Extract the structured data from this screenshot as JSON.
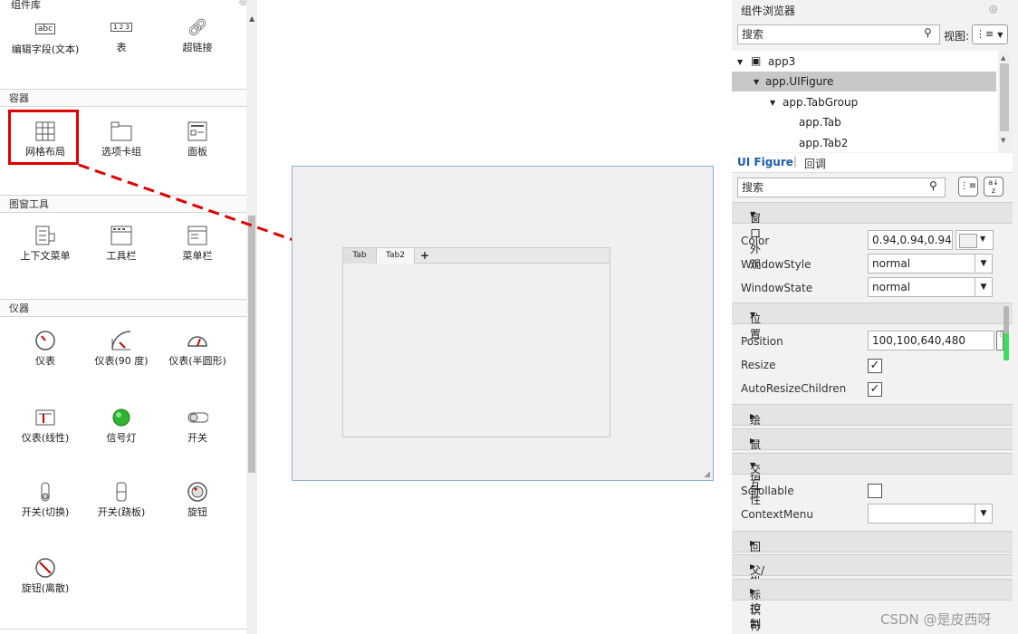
{
  "library": {
    "header": "组件库",
    "top_items": [
      {
        "icon": "text-area-icon",
        "icon_text": "abc",
        "label": "编辑字段(文本)"
      },
      {
        "icon": "table-icon",
        "icon_text": "1 2 3",
        "label": "表"
      },
      {
        "icon": "hyperlink-icon",
        "label": "超链接"
      }
    ],
    "sections": [
      {
        "title": "容器",
        "items": [
          {
            "icon": "grid-layout-icon",
            "label": "网格布局"
          },
          {
            "icon": "tab-group-icon",
            "label": "选项卡组"
          },
          {
            "icon": "panel-icon",
            "label": "面板"
          }
        ]
      },
      {
        "title": "图窗工具",
        "items": [
          {
            "icon": "context-menu-icon",
            "label": "上下文菜单"
          },
          {
            "icon": "toolbar-icon",
            "label": "工具栏"
          },
          {
            "icon": "menu-bar-icon",
            "label": "菜单栏"
          }
        ]
      },
      {
        "title": "仪器",
        "items": [
          {
            "icon": "gauge-icon",
            "label": "仪表"
          },
          {
            "icon": "gauge-90-icon",
            "label": "仪表(90 度)"
          },
          {
            "icon": "semicircular-gauge-icon",
            "label": "仪表(半圆形)"
          },
          {
            "icon": "linear-gauge-icon",
            "label": "仪表(线性)"
          },
          {
            "icon": "lamp-icon",
            "label": "信号灯"
          },
          {
            "icon": "switch-icon",
            "label": "开关"
          },
          {
            "icon": "toggle-switch-icon",
            "label": "开关(切换)"
          },
          {
            "icon": "rocker-switch-icon",
            "label": "开关(跷板)"
          },
          {
            "icon": "knob-icon",
            "label": "旋钮"
          },
          {
            "icon": "discrete-knob-icon",
            "label": "旋钮(离散)"
          }
        ]
      }
    ]
  },
  "canvas": {
    "tabs": [
      "Tab",
      "Tab2"
    ],
    "add_tab": "+"
  },
  "browser": {
    "header": "组件浏览器",
    "search_placeholder": "搜索",
    "view_label": "视图:",
    "tree": [
      {
        "label": "app3",
        "level": 0,
        "selected": false
      },
      {
        "label": "app.UIFigure",
        "level": 1,
        "selected": true
      },
      {
        "label": "app.TabGroup",
        "level": 2,
        "selected": false
      },
      {
        "label": "app.Tab",
        "level": 3,
        "selected": false
      },
      {
        "label": "app.Tab2",
        "level": 3,
        "selected": false
      }
    ]
  },
  "inspector": {
    "tab_active": "UI Figure",
    "tab_other": "回调",
    "search_placeholder": "搜索",
    "groups": {
      "appearance": "窗口外观",
      "position": "位置",
      "plotting": "绘图",
      "mouse_pointer": "鼠标指针",
      "interactivity": "交互性",
      "callback_control": "回调执行控制",
      "parent_child": "父/子",
      "identifiers": "标识符"
    },
    "props": {
      "color_label": "Color",
      "color_value": "0.94,0.94,0.94",
      "windowstyle_label": "WindowStyle",
      "windowstyle_value": "normal",
      "windowstate_label": "WindowState",
      "windowstate_value": "normal",
      "position_label": "Position",
      "position_value": "100,100,640,480",
      "resize_label": "Resize",
      "autoresize_label": "AutoResizeChildren",
      "scrollable_label": "Scrollable",
      "contextmenu_label": "ContextMenu",
      "contextmenu_value": ""
    },
    "swatch_color": "#f0f0f0"
  },
  "watermark": "CSDN @是皮西呀",
  "colors": {
    "highlight": "#e00000",
    "selected_row": "#c8c8c8",
    "accent": "#1a5ea8",
    "lamp": "#2fb42f"
  }
}
